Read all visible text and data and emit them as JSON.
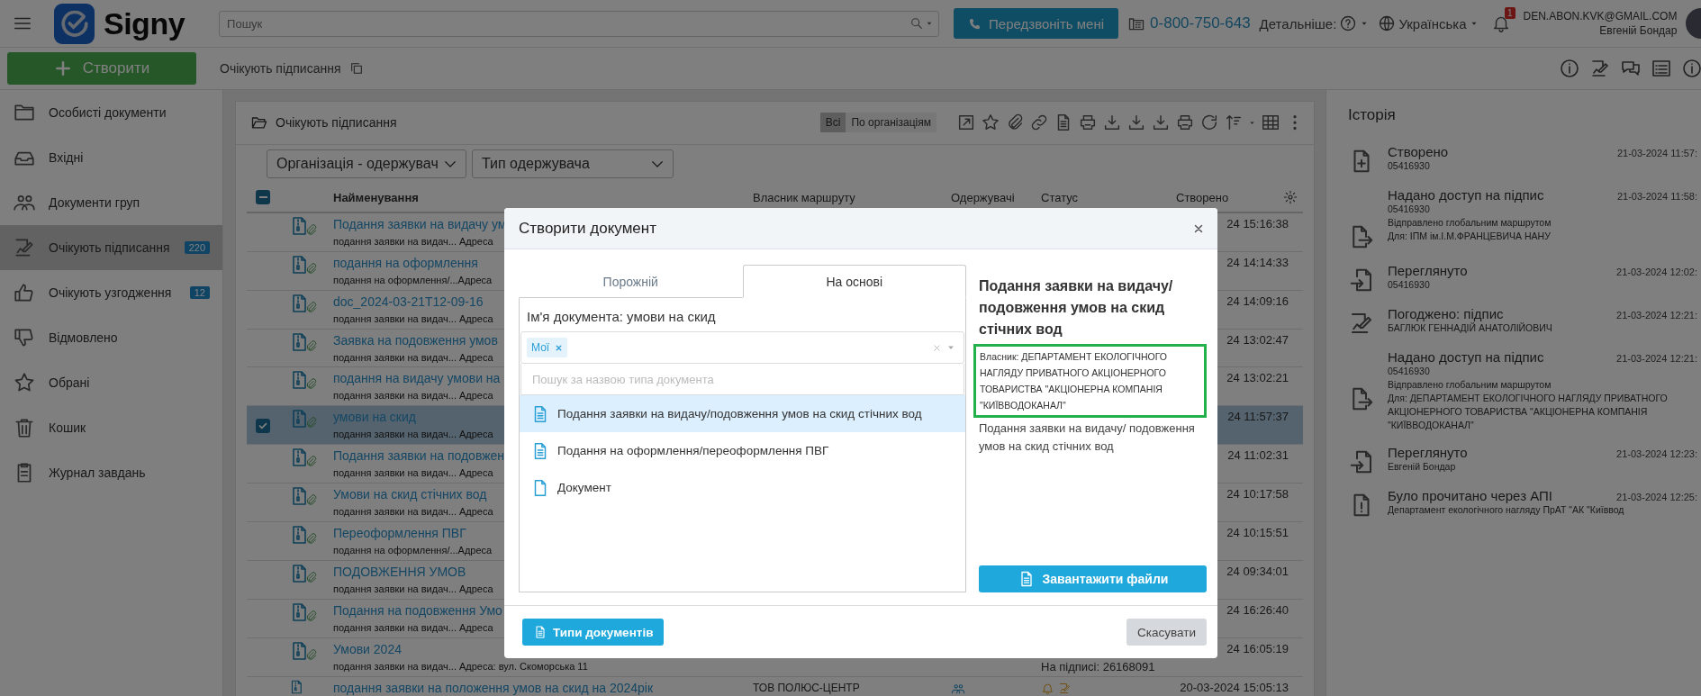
{
  "header": {
    "logo": "Signy",
    "search": {
      "placeholder": "Пошук"
    },
    "callback_button": "Передзвоніть мені",
    "phone": "0-800-750-643",
    "details_label": "Детальніше:",
    "language": "Українська",
    "notification_count": "1",
    "user": {
      "email": "DEN.ABON.KVK@GMAIL.COM",
      "name": "Евгеній Бондар"
    }
  },
  "toolbar": {
    "create_button": "Створити",
    "breadcrumb": "Очікують підписання"
  },
  "sidebar": {
    "items": [
      {
        "label": "Особисті документи",
        "selected": false
      },
      {
        "label": "Вхідні",
        "selected": false
      },
      {
        "label": "Документи груп",
        "selected": false
      },
      {
        "label": "Очікують підписання",
        "badge": "220",
        "selected": true
      },
      {
        "label": "Очікують узгодження",
        "badge": "12",
        "selected": false
      },
      {
        "label": "Відмовлено",
        "selected": false
      },
      {
        "label": "Обрані",
        "selected": false
      },
      {
        "label": "Кошик",
        "selected": false
      },
      {
        "label": "Журнал завдань",
        "selected": false
      }
    ]
  },
  "documents_panel": {
    "title": "Очікують підписання",
    "view_toggle": [
      {
        "label": "Всі",
        "selected": true
      },
      {
        "label": "По організаціям",
        "selected": false
      }
    ],
    "filters": [
      {
        "value": "Організація - одержувач"
      },
      {
        "value": "Тип одержувача"
      }
    ],
    "select_all": {
      "indeterminate": true
    },
    "columns": [
      "Найменування",
      "Власник маршруту",
      "Одержувачі",
      "Статус",
      "Створено"
    ],
    "rows": [
      {
        "title": "Подання заявки на видачу ум",
        "subtitle": "подання заявки на видач... Адреса",
        "created": "24 15:16:38",
        "selected": false
      },
      {
        "title": "подання на оформлення",
        "subtitle": "подання на оформлення/...Адреса",
        "created": "24 14:14:33",
        "selected": false
      },
      {
        "title": "doc_2024-03-21T12-09-16",
        "subtitle": "подання заявки на видач... Адреса",
        "created": "24 14:09:16",
        "selected": false
      },
      {
        "title": "Заявка на подовження умов",
        "subtitle": "подання заявки на видач... Адреса",
        "created": "24 13:02:47",
        "selected": false
      },
      {
        "title": "подання на видачу умови на",
        "subtitle": "подання заявки на видач... Адреса",
        "created": "24 13:02:21",
        "selected": false
      },
      {
        "title": "умови на скид",
        "subtitle": "подання заявки на видач... Адреса",
        "created": "24 11:57:37",
        "selected": true
      },
      {
        "title": "Подання заявки на подовжен",
        "subtitle": "подання заявки на видач... Адреса",
        "created": "24 11:02:31",
        "selected": false
      },
      {
        "title": "Умови на скид стічних вод",
        "subtitle": "подання заявки на видач... Адреса",
        "created": "24 10:17:58",
        "selected": false
      },
      {
        "title": "Переоформлення ПВГ",
        "subtitle": "подання на оформлення/...Адреса",
        "created": "24 10:15:51",
        "selected": false
      },
      {
        "title": "ПОДОВЖЕННЯ УМОВ",
        "subtitle": "подання заявки на видач... Адреса",
        "created": "24 09:34:01",
        "selected": false
      },
      {
        "title": "Подання на подовження Умо",
        "subtitle": "подання заявки на видач... Адреса",
        "created": "24 16:26:40",
        "selected": false
      },
      {
        "title": "Умови 2024",
        "subtitle": "подання заявки на видач... Адреса: вул. Скоморська 11",
        "status": "На підписі: 26168091",
        "created": "24 16:05:19",
        "selected": false
      },
      {
        "title": "подання заявки на положення умов на скид на 2024рік",
        "owner": "ТОВ ПОЛЮС-ЦЕНТР",
        "recipients_group": true,
        "status_icons": true,
        "created": "20-03-2024 15:05:13",
        "selected": false
      }
    ]
  },
  "history": {
    "title": "Історія",
    "items": [
      {
        "kind": "created",
        "title": "Створено",
        "time": "21-03-2024 11:57:",
        "lines": [
          "05416930"
        ]
      },
      {
        "kind": "shared",
        "title": "Надано доступ на підпис",
        "time": "21-03-2024 11:58:",
        "lines": [
          "05416930",
          "Відправлено глобальним маршрутом",
          "Для: ІПМ ім.І.М.ФРАНЦЕВИЧА НАНУ"
        ]
      },
      {
        "kind": "viewed",
        "title": "Переглянуто",
        "time": "21-03-2024 12:02:",
        "lines": [
          "05416930"
        ]
      },
      {
        "kind": "signed",
        "title": "Погоджено: підпис",
        "time": "21-03-2024 12:21:",
        "lines": [
          "БАГЛЮК ГЕННАДІЙ АНАТОЛІЙОВИЧ"
        ]
      },
      {
        "kind": "shared",
        "title": "Надано доступ на підпис",
        "time": "21-03-2024 12:21:",
        "lines": [
          "05416930",
          "Відправлено глобальним маршрутом",
          "Для: ДЕПАРТАМЕНТ ЕКОЛОГІЧНОГО НАГЛЯДУ ПРИВАТНОГО АКЦІОНЕРНОГО ТОВАРИСТВА \"АКЦІОНЕРНА КОМПАНІЯ \"КИЇВВОДОКАНАЛ\""
        ]
      },
      {
        "kind": "viewed",
        "title": "Переглянуто",
        "time": "21-03-2024 12:23:",
        "lines": [
          "Евгеній Бондар"
        ]
      },
      {
        "kind": "read",
        "title": "Було прочитано через АПІ",
        "time": "21-03-2024 12:25:",
        "lines": [
          "Департамент екологічного нагляду ПрАТ \"АК \"Київвод"
        ]
      }
    ]
  },
  "modal": {
    "title": "Створити документ",
    "tabs": [
      {
        "label": "Порожній",
        "selected": false
      },
      {
        "label": "На основі",
        "selected": true
      }
    ],
    "document_name": "Ім'я документа: умови на скид",
    "type_filter": {
      "tags": [
        "Мої"
      ]
    },
    "search": {
      "placeholder": "Пошук за назвою типа документа"
    },
    "types": [
      {
        "label": "Подання заявки на видачу/подовження умов на скид стічних вод",
        "kind": "template",
        "selected": true
      },
      {
        "label": "Подання на оформлення/переоформлення ПВГ",
        "kind": "template",
        "selected": false
      },
      {
        "label": "Документ",
        "kind": "blank",
        "selected": false
      }
    ],
    "details": {
      "title": "Подання заявки на видачу/ подовження умов на скид стічних вод",
      "owner": "Власник: ДЕПАРТАМЕНТ ЕКОЛОГІЧНОГО НАГЛЯДУ ПРИВАТНОГО АКЦІОНЕРНОГО ТОВАРИСТВА \"АКЦІОНЕРНА КОМПАНІЯ \"КИЇВВОДОКАНАЛ\"",
      "description": "Подання заявки на видачу/ подовження умов на скид стічних вод"
    },
    "upload_button": "Завантажити файли",
    "types_button": "Типи документів",
    "cancel_button": "Скасувати"
  }
}
